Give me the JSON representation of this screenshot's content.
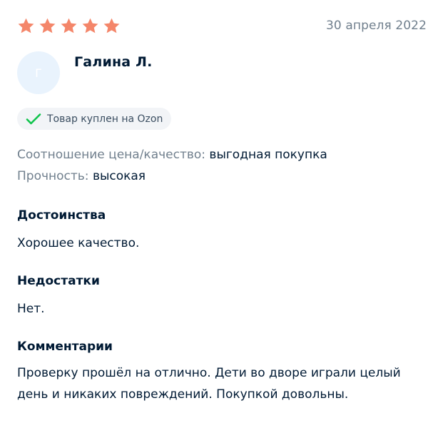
{
  "rating": {
    "stars": 5,
    "max": 5,
    "star_color": "#f4866a"
  },
  "date": "30 апреля 2022",
  "author": {
    "avatar_letter": "Г",
    "name": "Галина Л."
  },
  "badge": {
    "label": "Товар куплен на Ozon",
    "check_color": "#10c44c"
  },
  "attributes": [
    {
      "label": "Соотношение цена/качество:",
      "value": "выгодная покупка"
    },
    {
      "label": "Прочность:",
      "value": "высокая"
    }
  ],
  "sections": {
    "pros": {
      "title": "Достоинства",
      "text": "Хорошее качество."
    },
    "cons": {
      "title": "Недостатки",
      "text": "Нет."
    },
    "comment": {
      "title": "Комментарии",
      "text": "Проверку прошёл на отлично. Дети во дворе играли целый день и никаких повреждений. Покупкой довольны."
    }
  }
}
